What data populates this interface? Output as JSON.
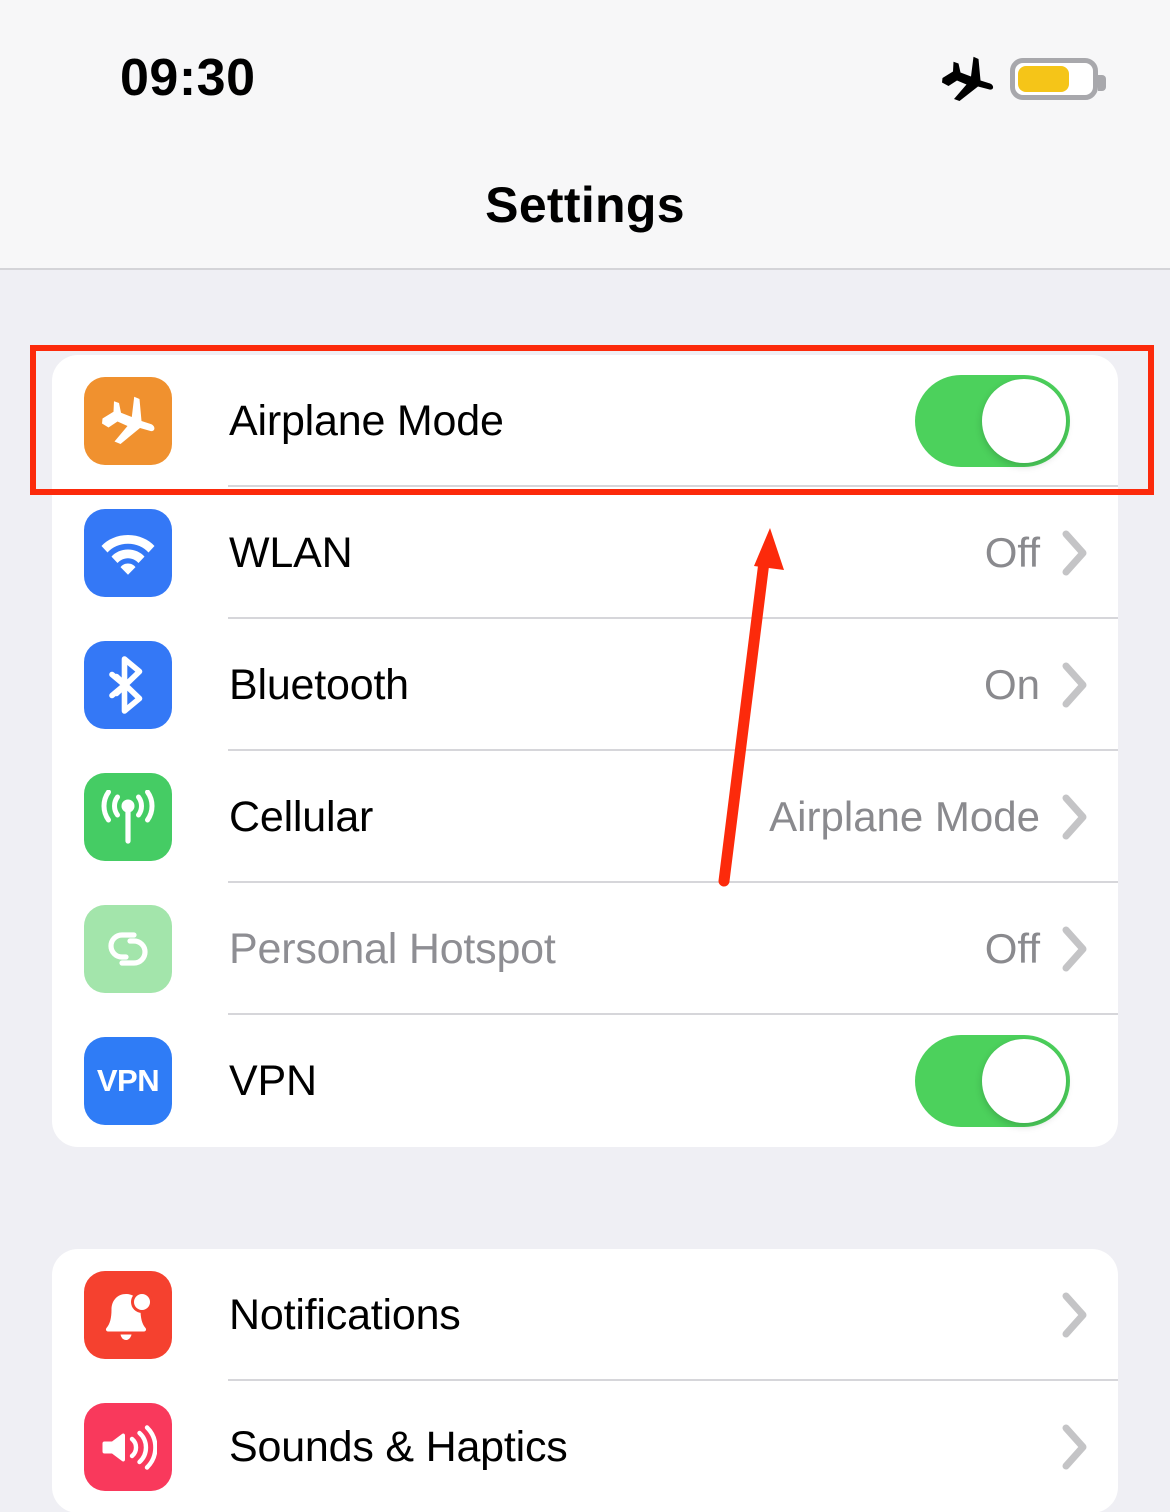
{
  "status_bar": {
    "time": "09:30",
    "airplane_icon": "airplane-icon",
    "battery_icon": "battery-icon",
    "battery_level_percent": 66,
    "battery_color": "#f5c518"
  },
  "header": {
    "title": "Settings"
  },
  "theme": {
    "page_background": "#efeff4",
    "card_background": "#ffffff",
    "separator": "#d6d6da",
    "label_color": "#000000",
    "value_color": "#8a8a8e",
    "chevron_color": "#c4c4c6",
    "switch_on_color": "#4cd15c",
    "annotation_color": "#fc2a0b"
  },
  "sections": [
    {
      "id": "connectivity",
      "rows": [
        {
          "label": "Airplane Mode",
          "icon_name": "airplane-icon",
          "icon_color": "#f0912f",
          "accessory": "switch",
          "switch_on": true,
          "value": "",
          "disabled": false
        },
        {
          "label": "WLAN",
          "icon_name": "wifi-icon",
          "icon_color": "#3478f6",
          "accessory": "chevron",
          "value": "Off",
          "disabled": false
        },
        {
          "label": "Bluetooth",
          "icon_name": "bluetooth-icon",
          "icon_color": "#3478f6",
          "accessory": "chevron",
          "value": "On",
          "disabled": false
        },
        {
          "label": "Cellular",
          "icon_name": "cellular-antenna-icon",
          "icon_color": "#45cc64",
          "accessory": "chevron",
          "value": "Airplane Mode",
          "disabled": false
        },
        {
          "label": "Personal Hotspot",
          "icon_name": "personal-hotspot-icon",
          "icon_color": "#a3e5ab",
          "accessory": "chevron",
          "value": "Off",
          "disabled": true
        },
        {
          "label": "VPN",
          "icon_name": "vpn-icon",
          "icon_color": "#2f7cf6",
          "icon_text": "VPN",
          "accessory": "switch",
          "switch_on": true,
          "value": "",
          "disabled": false
        }
      ]
    },
    {
      "id": "alerts",
      "rows": [
        {
          "label": "Notifications",
          "icon_name": "bell-icon",
          "icon_color": "#f5412f",
          "accessory": "chevron",
          "value": "",
          "disabled": false
        },
        {
          "label": "Sounds & Haptics",
          "icon_name": "speaker-wave-icon",
          "icon_color": "#f9395c",
          "accessory": "chevron",
          "value": "",
          "disabled": false
        }
      ]
    }
  ],
  "annotations": {
    "highlight_box_target": "Airplane Mode",
    "arrow_points_to": "Airplane Mode"
  }
}
